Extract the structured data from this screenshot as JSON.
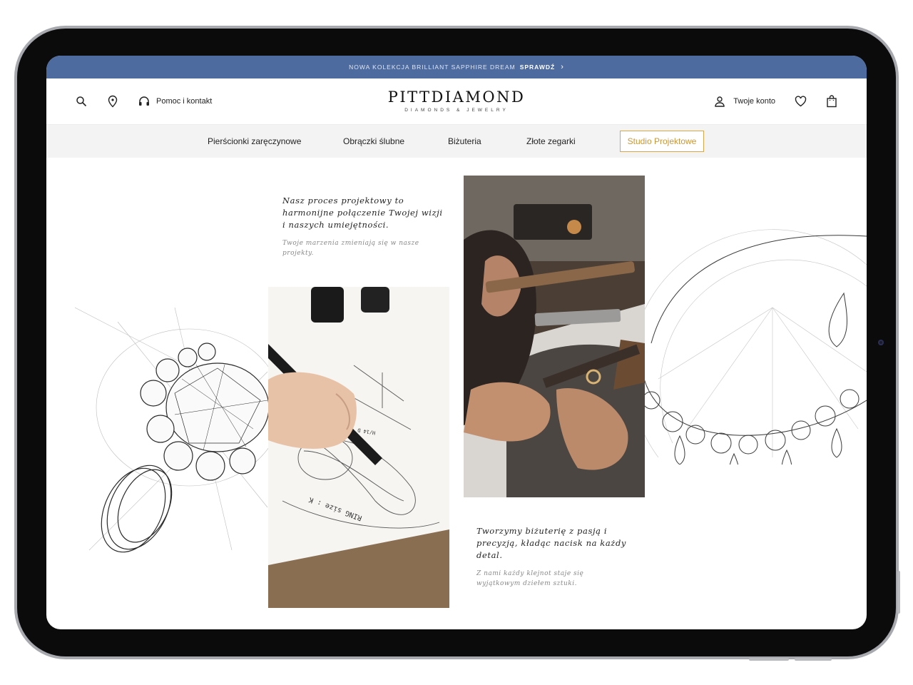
{
  "promo": {
    "text": "NOWA KOLEKCJA BRILLIANT SAPPHIRE DREAM",
    "cta": "SPRAWDŹ"
  },
  "header": {
    "help_label": "Pomoc i kontakt",
    "brand": "PITTDIAMOND",
    "tagline": "DIAMONDS & JEWELRY",
    "account_label": "Twoje konto"
  },
  "nav": {
    "items": [
      "Pierścionki zaręczynowe",
      "Obrączki ślubne",
      "Biżuteria",
      "Złote zegarki"
    ],
    "studio": "Studio Projektowe"
  },
  "content": {
    "intro_title": "Nasz proces projektowy to harmonijne połączenie Twojej wizji i naszych umiejętności.",
    "intro_sub": "Twoje marzenia zmieniają się w nasze projekty.",
    "outro_title": "Tworzymy biżuterię z pasją i precyzją, kładąc nacisk na każdy detal.",
    "outro_sub": "Z nami każdy klejnot staje się wyjątkowym dziełem sztuki.",
    "sketch_labels": [
      "RING size : K",
      "H/14 D"
    ]
  },
  "colors": {
    "promo_bg": "#4d6b9f",
    "accent_gold": "#c9973b",
    "nav_bg": "#f3f3f3"
  }
}
